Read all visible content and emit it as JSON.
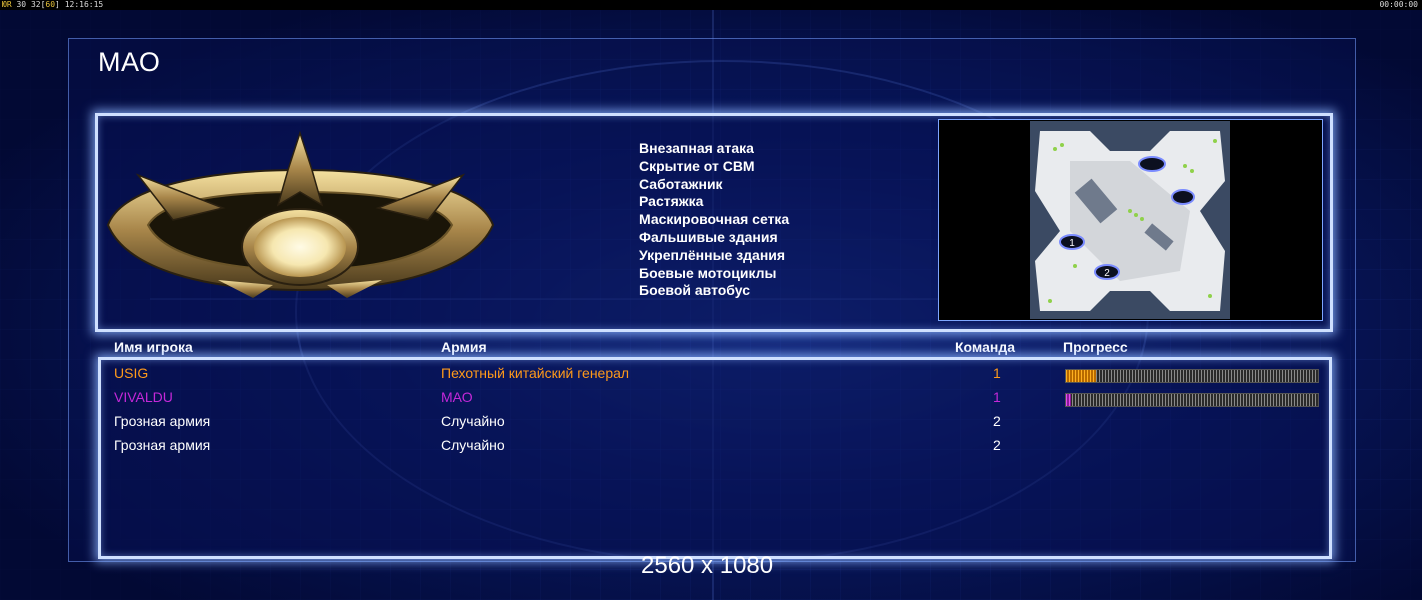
{
  "status_bar": {
    "left_label": "ЮR",
    "fps": "30",
    "fps_target_open": "32[",
    "fps_target": "60",
    "fps_target_close": "]",
    "clock": "12:16:15",
    "right_timer": "00:00:00"
  },
  "header": {
    "title": "МАО"
  },
  "general": {
    "bonuses": [
      "Внезапная атака",
      "Скрытие от СВМ",
      "Саботажник",
      "Растяжка",
      "Маскировочная сетка",
      "Фальшивые здания",
      "Укреплённые здания",
      "Боевые мотоциклы",
      "Боевой автобус"
    ]
  },
  "minimap": {
    "start_labels": [
      "1",
      "2"
    ]
  },
  "table": {
    "headers": {
      "player": "Имя игрока",
      "army": "Армия",
      "team": "Команда",
      "progress": "Прогресс"
    },
    "rows": [
      {
        "name": "USIG",
        "army": "Пехотный китайский генерал",
        "team": "1",
        "progress": 0.12,
        "color": "#ff9a1a"
      },
      {
        "name": "VIVALDU",
        "army": "МАО",
        "team": "1",
        "progress": 0.02,
        "color": "#c428d8"
      },
      {
        "name": "Грозная армия",
        "army": "Случайно",
        "team": "2",
        "color": "#ffffff"
      },
      {
        "name": "Грозная армия",
        "army": "Случайно",
        "team": "2",
        "color": "#ffffff"
      }
    ]
  },
  "footer": {
    "resolution": "2560 x 1080"
  },
  "colors": {
    "panel_border": "#cfe0ff",
    "background": "#06124a",
    "usig": "#ff9a1a",
    "vivaldu": "#c428d8"
  },
  "icons": {
    "emblem": "china-general-emblem-icon",
    "map": "minimap-icon"
  }
}
